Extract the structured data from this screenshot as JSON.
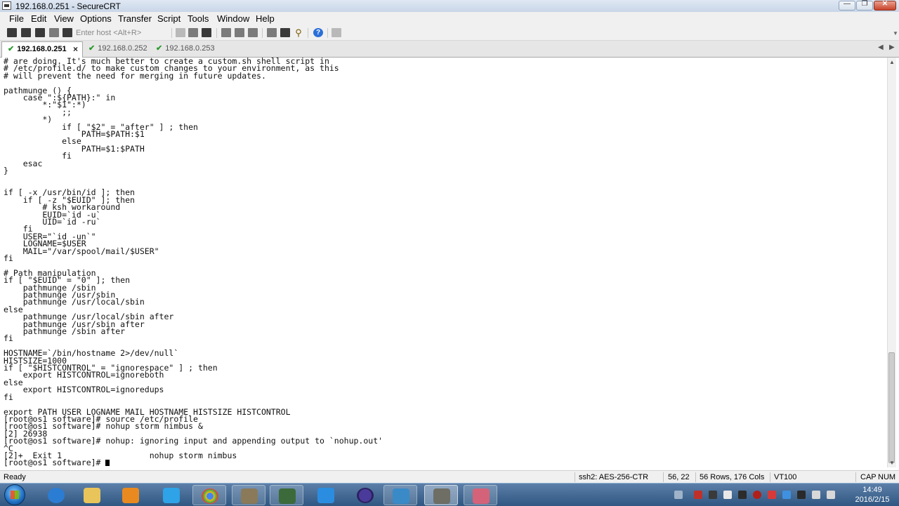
{
  "window": {
    "title": "192.168.0.251 - SecureCRT"
  },
  "menu": [
    "File",
    "Edit",
    "View",
    "Options",
    "Transfer",
    "Script",
    "Tools",
    "Window",
    "Help"
  ],
  "toolbar": {
    "host_placeholder": "Enter host <Alt+R>"
  },
  "tabs": [
    {
      "label": "192.168.0.251",
      "active": true
    },
    {
      "label": "192.168.0.252",
      "active": false
    },
    {
      "label": "192.168.0.253",
      "active": false
    }
  ],
  "terminal": {
    "lines": [
      "# are doing. It's much better to create a custom.sh shell script in",
      "# /etc/profile.d/ to make custom changes to your environment, as this",
      "# will prevent the need for merging in future updates.",
      "",
      "pathmunge () {",
      "    case \":${PATH}:\" in",
      "        *:\"$1\":*)",
      "            ;;",
      "        *)",
      "            if [ \"$2\" = \"after\" ] ; then",
      "                PATH=$PATH:$1",
      "            else",
      "                PATH=$1:$PATH",
      "            fi",
      "    esac",
      "}",
      "",
      "",
      "if [ -x /usr/bin/id ]; then",
      "    if [ -z \"$EUID\" ]; then",
      "        # ksh workaround",
      "        EUID=`id -u`",
      "        UID=`id -ru`",
      "    fi",
      "    USER=\"`id -un`\"",
      "    LOGNAME=$USER",
      "    MAIL=\"/var/spool/mail/$USER\"",
      "fi",
      "",
      "# Path manipulation",
      "if [ \"$EUID\" = \"0\" ]; then",
      "    pathmunge /sbin",
      "    pathmunge /usr/sbin",
      "    pathmunge /usr/local/sbin",
      "else",
      "    pathmunge /usr/local/sbin after",
      "    pathmunge /usr/sbin after",
      "    pathmunge /sbin after",
      "fi",
      "",
      "HOSTNAME=`/bin/hostname 2>/dev/null`",
      "HISTSIZE=1000",
      "if [ \"$HISTCONTROL\" = \"ignorespace\" ] ; then",
      "    export HISTCONTROL=ignoreboth",
      "else",
      "    export HISTCONTROL=ignoredups",
      "fi",
      "",
      "export PATH USER LOGNAME MAIL HOSTNAME HISTSIZE HISTCONTROL",
      "[root@os1 software]# source /etc/profile",
      "[root@os1 software]# nohup storm nimbus &",
      "[2] 26938",
      "[root@os1 software]# nohup: ignoring input and appending output to `nohup.out'",
      "^C",
      "[2]+  Exit 1                  nohup storm nimbus",
      "[root@os1 software]# "
    ]
  },
  "status": {
    "ready": "Ready",
    "cipher": "ssh2: AES-256-CTR",
    "position": "56,  22",
    "size": "56 Rows, 176 Cols",
    "emulation": "VT100",
    "caps": "CAP",
    "num": "NUM"
  },
  "taskbar": {
    "apps": [
      "internet-explorer",
      "file-explorer",
      "media-player",
      "link-app",
      "chrome",
      "tool-app",
      "network-app",
      "feather-app",
      "eclipse",
      "app-window",
      "securecrt",
      "flower-app"
    ],
    "clock_time": "14:49",
    "clock_date": "2016/2/15"
  }
}
